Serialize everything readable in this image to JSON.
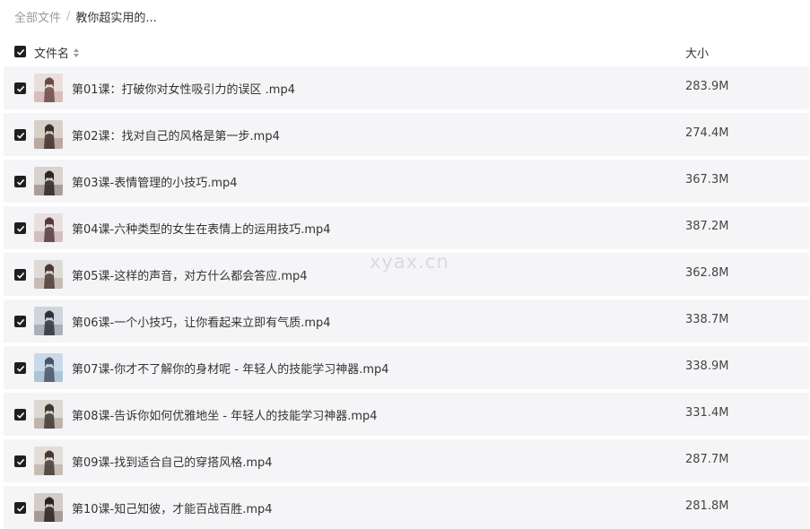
{
  "breadcrumb": {
    "root": "全部文件",
    "separator": "/",
    "current": "教你超实用的..."
  },
  "header": {
    "name_label": "文件名",
    "size_label": "大小"
  },
  "files": [
    {
      "name": "第01课：打破你对女性吸引力的误区 .mp4",
      "size": "283.9M"
    },
    {
      "name": "第02课：找对自己的风格是第一步.mp4",
      "size": "274.4M"
    },
    {
      "name": "第03课-表情管理的小技巧.mp4",
      "size": "367.3M"
    },
    {
      "name": "第04课-六种类型的女生在表情上的运用技巧.mp4",
      "size": "387.2M"
    },
    {
      "name": "第05课-这样的声音，对方什么都会答应.mp4",
      "size": "362.8M"
    },
    {
      "name": "第06课-一个小技巧，让你看起来立即有气质.mp4",
      "size": "338.7M"
    },
    {
      "name": "第07课-你才不了解你的身材呢 - 年轻人的技能学习神器.mp4",
      "size": "338.9M"
    },
    {
      "name": "第08课-告诉你如何优雅地坐 - 年轻人的技能学习神器.mp4",
      "size": "331.4M"
    },
    {
      "name": "第09课-找到适合自己的穿搭风格.mp4",
      "size": "287.7M"
    },
    {
      "name": "第10课-知己知彼，才能百战百胜.mp4",
      "size": "281.8M"
    }
  ],
  "watermark": "xyax.cn",
  "icons": {
    "checkbox": "checkbox-checked-icon",
    "sort": "sort-icon",
    "thumbnail": "video-thumbnail"
  },
  "colors": {
    "row_bg": "#f5f5f7",
    "checkbox": "#1f1f1f",
    "muted_text": "#999999"
  }
}
